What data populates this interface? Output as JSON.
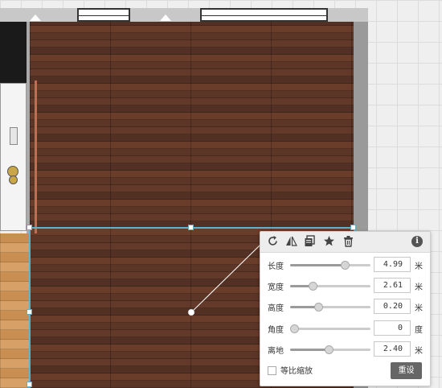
{
  "panel": {
    "toolbar": {
      "rotate_icon": "rotate-icon",
      "mirror_icon": "mirror-icon",
      "copy_icon": "copy-icon",
      "favorite_icon": "star-icon",
      "delete_icon": "trash-icon",
      "info_icon": "info-icon",
      "info_glyph": "i"
    },
    "properties": [
      {
        "key": "length",
        "label": "长度",
        "value": "4.99",
        "unit": "米",
        "slider": 0.68
      },
      {
        "key": "width",
        "label": "宽度",
        "value": "2.61",
        "unit": "米",
        "slider": 0.28
      },
      {
        "key": "height",
        "label": "高度",
        "value": "0.20",
        "unit": "米",
        "slider": 0.35
      },
      {
        "key": "angle",
        "label": "角度",
        "value": "0",
        "unit": "度",
        "slider": 0.05
      },
      {
        "key": "elevation",
        "label": "离地",
        "value": "2.40",
        "unit": "米",
        "slider": 0.48
      }
    ],
    "proportional_scale_label": "等比缩放",
    "proportional_scale_checked": false,
    "reset_label": "重设"
  },
  "colors": {
    "accent": "#5fb3c8",
    "panel_bg": "#ffffff",
    "reset_bg": "#666666",
    "floor_dark": "#5a3426",
    "floor_light": "#d29a5c"
  }
}
